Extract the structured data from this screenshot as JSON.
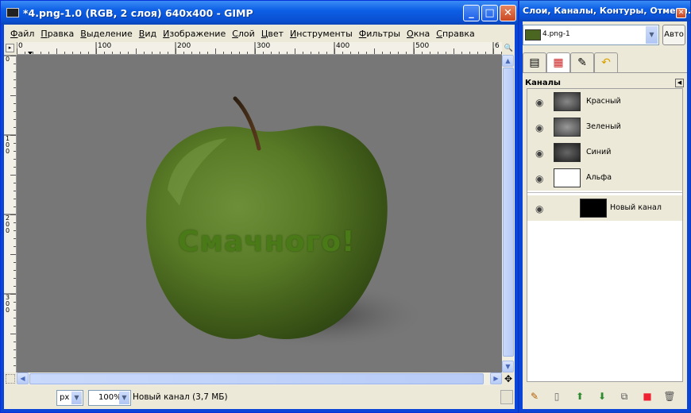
{
  "main_window": {
    "title": "*4.png-1.0 (RGB, 2 слоя) 640x400 - GIMP",
    "menu": [
      "Файл",
      "Правка",
      "Выделение",
      "Вид",
      "Изображение",
      "Слой",
      "Цвет",
      "Инструменты",
      "Фильтры",
      "Окна",
      "Справка"
    ],
    "ruler_h_labels": [
      "0",
      "100",
      "200",
      "300",
      "400",
      "500",
      "6"
    ],
    "ruler_v_labels": [
      "0",
      "100",
      "200",
      "300"
    ],
    "canvas_text": "Смачного!",
    "status": {
      "unit": "px",
      "zoom": "100%",
      "message": "Новый канал (3,7 МБ)"
    }
  },
  "dock": {
    "title": "Слои, Каналы, Контуры, Отмени...",
    "image_combo": "4.png-1",
    "auto_button": "Авто",
    "section_title": "Каналы",
    "channels": [
      {
        "label": "Красный"
      },
      {
        "label": "Зеленый"
      },
      {
        "label": "Синий"
      },
      {
        "label": "Альфа"
      }
    ],
    "custom_channel": {
      "label": "Новый канал"
    }
  },
  "colors": {
    "xp_blue": "#0a45d8",
    "canvas_bg": "#777777",
    "apple_green": "#4f6b1e",
    "text_green": "#3f6515"
  }
}
